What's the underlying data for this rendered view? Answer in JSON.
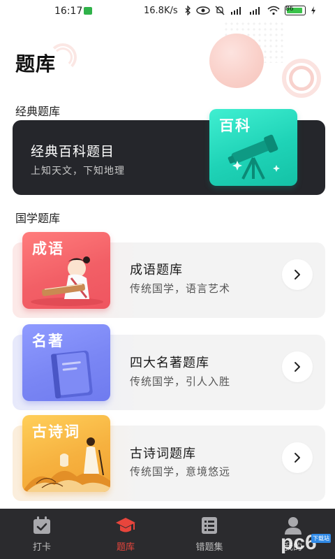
{
  "status_bar": {
    "time": "16:17",
    "speed": "16.8K/s",
    "battery": "86"
  },
  "colors": {
    "accent": "#e8453c",
    "dark_card": "#25262b",
    "teal_tile": "#1fd3b7",
    "red_tile": "#f25f66",
    "blue_tile": "#7a86f4",
    "orange_tile": "#f6b13f",
    "nav_bg": "#2b2b2e"
  },
  "page": {
    "title": "题库"
  },
  "classic_section": {
    "heading": "经典题库",
    "card": {
      "title": "经典百科题目",
      "subtitle": "上知天文，下知地理",
      "tile_label": "百科",
      "icon": "telescope-icon"
    }
  },
  "guoxue_section": {
    "heading": "国学题库",
    "cards": [
      {
        "tile_label": "成语",
        "title": "成语题库",
        "subtitle": "传统国学，语言艺术",
        "icon": "scholar-with-guqin-icon"
      },
      {
        "tile_label": "名著",
        "title": "四大名著题库",
        "subtitle": "传统国学，引人入胜",
        "icon": "book-icon"
      },
      {
        "tile_label": "古诗词",
        "title": "古诗词题库",
        "subtitle": "传统国学，意境悠远",
        "icon": "poet-landscape-icon"
      }
    ]
  },
  "bottom_nav": {
    "items": [
      {
        "label": "打卡",
        "icon": "calendar-check-icon",
        "active": false
      },
      {
        "label": "题库",
        "icon": "graduation-cap-icon",
        "active": true
      },
      {
        "label": "错题集",
        "icon": "list-icon",
        "active": false
      },
      {
        "label": "我的",
        "icon": "user-icon",
        "active": false
      }
    ]
  },
  "watermark": {
    "text": "pc6",
    "tag": "下载站"
  }
}
